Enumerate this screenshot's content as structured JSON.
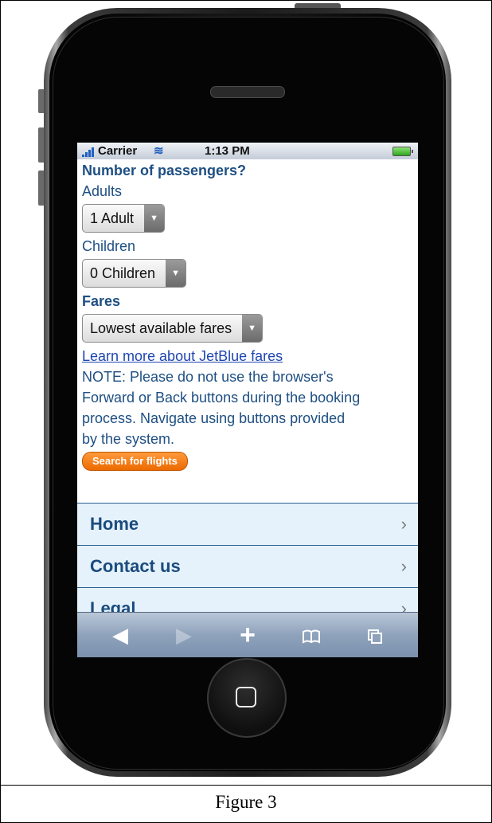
{
  "status_bar": {
    "carrier": "Carrier",
    "time": "1:13 PM"
  },
  "form": {
    "heading": "Number of passengers?",
    "adults_label": "Adults",
    "adults_value": "1 Adult",
    "children_label": "Children",
    "children_value": "0 Children",
    "fares_label": "Fares",
    "fares_value": "Lowest available fares",
    "learn_more_link": "Learn more about JetBlue fares",
    "note_lines": [
      "NOTE: Please do not use the browser's",
      "Forward or Back buttons during the booking",
      "process. Navigate using buttons provided",
      "by the system."
    ],
    "search_button": "Search for flights"
  },
  "nav": {
    "items": [
      {
        "label": "Home"
      },
      {
        "label": "Contact us"
      },
      {
        "label": "Legal"
      }
    ]
  },
  "toolbar": {
    "back_icon": "back-arrow-icon",
    "forward_icon": "forward-arrow-icon",
    "add_icon": "plus-icon",
    "bookmarks_icon": "book-icon",
    "pages_icon": "pages-icon"
  },
  "caption": "Figure 3",
  "colors": {
    "accent_orange": "#ec6a00",
    "text_blue": "#1e4f83",
    "nav_bg": "#e5f2fb"
  }
}
